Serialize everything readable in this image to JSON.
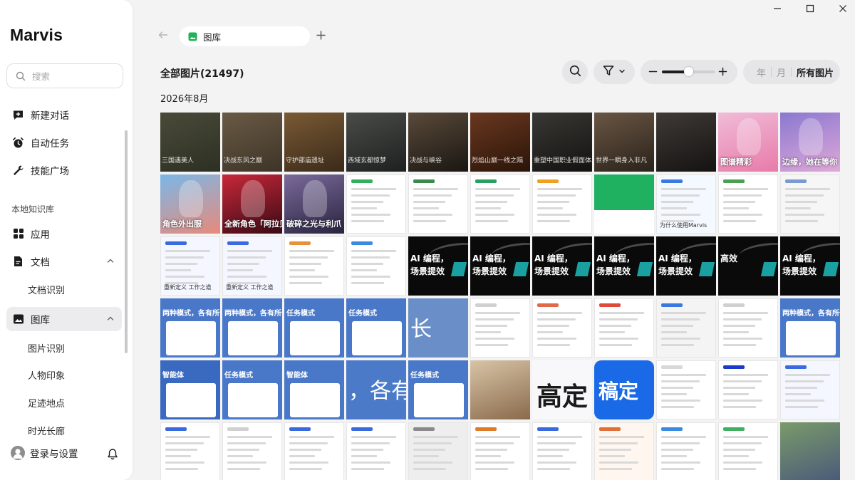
{
  "app": {
    "title": "Marvis"
  },
  "sidebar": {
    "search_placeholder": "搜索",
    "top_items": [
      {
        "label": "新建对话",
        "icon": "new-chat-icon"
      },
      {
        "label": "自动任务",
        "icon": "alarm-clock-icon"
      },
      {
        "label": "技能广场",
        "icon": "wrench-icon"
      }
    ],
    "section_label": "本地知识库",
    "kb_items": [
      {
        "label": "应用",
        "icon": "apps-grid-icon"
      },
      {
        "label": "文档",
        "icon": "document-icon"
      },
      {
        "label": "文档识别"
      },
      {
        "label": "图库",
        "icon": "gallery-icon"
      },
      {
        "label": "图片识别"
      },
      {
        "label": "人物印象"
      },
      {
        "label": "足迹地点"
      },
      {
        "label": "时光长廊"
      }
    ],
    "footer": {
      "login_label": "登录与设置"
    }
  },
  "tabs": [
    {
      "label": "图库",
      "icon": "gallery-icon"
    }
  ],
  "header": {
    "title": "全部图片(21497)",
    "zoom_level_fraction": 0.5,
    "segments": [
      {
        "label": "年",
        "selected": false
      },
      {
        "label": "月",
        "selected": false
      },
      {
        "label": "所有图片",
        "selected": true
      }
    ]
  },
  "group": {
    "date_label": "2026年8月",
    "rows": [
      [
        {
          "kind": "photo",
          "bg": "#4a4a3a",
          "bg2": "#2c3022",
          "caption": "三国遇美人"
        },
        {
          "kind": "photo",
          "bg": "#6a5a44",
          "bg2": "#3d3428",
          "caption": "决战东风之巅"
        },
        {
          "kind": "photo",
          "bg": "#7a5a34",
          "bg2": "#3a2a1a",
          "caption": "守护邵庙遗址"
        },
        {
          "kind": "photo",
          "bg": "#4a4c48",
          "bg2": "#1e2020",
          "caption": "西域玄都惊梦"
        },
        {
          "kind": "photo",
          "bg": "#5a4a3a",
          "bg2": "#1a1612",
          "caption": "决战与峡谷"
        },
        {
          "kind": "photo",
          "bg": "#6a3820",
          "bg2": "#2a1408",
          "caption": "烈焰山巅一线之隔"
        },
        {
          "kind": "photo",
          "bg": "#3a3834",
          "bg2": "#141210",
          "caption": "重塑中国职业假面体系"
        },
        {
          "kind": "photo",
          "bg": "#6a5644",
          "bg2": "#2a221a",
          "caption": "世界一瞬身入非凡"
        },
        {
          "kind": "photo",
          "bg": "#403a36",
          "bg2": "#141212",
          "caption": ""
        },
        {
          "kind": "anime",
          "bg": "#f0bcd8",
          "bg2": "#e87aa8",
          "big": "图谱精彩"
        },
        {
          "kind": "anime",
          "bg": "#8a78d0",
          "bg2": "#e0a8d8",
          "big": "边缘，她在等你"
        }
      ],
      [
        {
          "kind": "anime",
          "bg": "#7ab8e8",
          "bg2": "#e88a7a",
          "big": "角色外出服"
        },
        {
          "kind": "anime",
          "bg": "#c8283a",
          "bg2": "#3a0a14",
          "big": "全新角色「阿拉贝拉」"
        },
        {
          "kind": "anime",
          "bg": "#7a6a9a",
          "bg2": "#2a2440",
          "big": "破碎之光与利爪"
        },
        {
          "kind": "doc",
          "bg": "#ffffff",
          "accent": "#2fb05a"
        },
        {
          "kind": "doc",
          "bg": "#ffffff",
          "accent": "#3a8a4a"
        },
        {
          "kind": "doc",
          "bg": "#ffffff",
          "accent": "#2aa060"
        },
        {
          "kind": "doc",
          "bg": "#ffffff",
          "accent": "#f0a020"
        },
        {
          "kind": "green",
          "bg": "#1fb060",
          "bg2": "#ffffff"
        },
        {
          "kind": "doc",
          "bg": "#f4f8ff",
          "accent": "#3a7ae0",
          "caption": "为什么使用Marvis"
        },
        {
          "kind": "doc",
          "bg": "#ffffff",
          "accent": "#4aa050"
        },
        {
          "kind": "doc",
          "bg": "#f6f6f6",
          "accent": "#7a9ad0"
        }
      ],
      [
        {
          "kind": "doc",
          "bg": "#f4f7ff",
          "accent": "#3a6ae0",
          "caption": "重新定义 工作之道"
        },
        {
          "kind": "doc",
          "bg": "#f4f7ff",
          "accent": "#3a6ae0",
          "caption": "重新定义 工作之道"
        },
        {
          "kind": "doc",
          "bg": "#ffffff",
          "accent": "#e8903a"
        },
        {
          "kind": "doc",
          "bg": "#ffffff",
          "accent": "#3a8ae0"
        },
        {
          "kind": "dark",
          "bg": "#0a0a0a",
          "accent": "#1aa0a0",
          "big": "AI 编程，",
          "big2": "场景提效"
        },
        {
          "kind": "dark",
          "bg": "#0a0a0a",
          "accent": "#1aa0a0",
          "big": "AI 编程，",
          "big2": "场景提效"
        },
        {
          "kind": "dark",
          "bg": "#0a0a0a",
          "accent": "#1aa0a0",
          "big": "AI 编程，",
          "big2": "场景提效"
        },
        {
          "kind": "dark",
          "bg": "#0a0a0a",
          "accent": "#1aa0a0",
          "big": "AI 编程，",
          "big2": "场景提效"
        },
        {
          "kind": "dark",
          "bg": "#0a0a0a",
          "accent": "#1aa0a0",
          "big": "AI 编程，",
          "big2": "场景提效"
        },
        {
          "kind": "dark",
          "bg": "#0a0a0a",
          "accent": "#1aa0a0",
          "big": "高效",
          "big2": ""
        },
        {
          "kind": "dark",
          "bg": "#0a0a0a",
          "accent": "#1aa0a0",
          "big": "AI 编程，",
          "big2": "场景提效"
        }
      ],
      [
        {
          "kind": "blue",
          "bg": "#4a78c8",
          "big": "两种模式，各有所长"
        },
        {
          "kind": "blue",
          "bg": "#4a78c8",
          "big": "两种模式，各有所长"
        },
        {
          "kind": "blue",
          "bg": "#4a78c8",
          "big": "任务模式"
        },
        {
          "kind": "blue",
          "bg": "#4a78c8",
          "big": "任务模式"
        },
        {
          "kind": "bluebig",
          "bg": "#6a8ec8",
          "big": "长"
        },
        {
          "kind": "doc",
          "bg": "#ffffff",
          "accent": "#d0d0d0"
        },
        {
          "kind": "doc",
          "bg": "#ffffff",
          "accent": "#e06a4a"
        },
        {
          "kind": "doc",
          "bg": "#ffffff",
          "accent": "#e04a3a"
        },
        {
          "kind": "doc",
          "bg": "#f4f4f4",
          "accent": "#3a7ae0"
        },
        {
          "kind": "doc",
          "bg": "#ffffff",
          "accent": "#d0d0d0"
        },
        {
          "kind": "blue",
          "bg": "#4a78c8",
          "big": "两种模式，各有所长"
        }
      ],
      [
        {
          "kind": "blue",
          "bg": "#3a6ac0",
          "big": "智能体"
        },
        {
          "kind": "blue",
          "bg": "#4a78c8",
          "big": "任务模式"
        },
        {
          "kind": "blue",
          "bg": "#4a78c8",
          "big": "智能体"
        },
        {
          "kind": "bluebig",
          "bg": "#4a7ac8",
          "big": "，各有"
        },
        {
          "kind": "blue",
          "bg": "#4a78c8",
          "big": "任务模式"
        },
        {
          "kind": "photo",
          "bg": "#d8c4a8",
          "bg2": "#8a6a4a",
          "caption": ""
        },
        {
          "kind": "bigtext",
          "bg": "#f8f8fa",
          "color": "#1a1a1a",
          "big": "高定"
        },
        {
          "kind": "bigtext",
          "bg": "#1a6ae8",
          "color": "#ffffff",
          "big": "稿定"
        },
        {
          "kind": "doc",
          "bg": "#ffffff",
          "accent": "#d8d8d8"
        },
        {
          "kind": "doc",
          "bg": "#ffffff",
          "accent": "#1a3ac8"
        },
        {
          "kind": "doc",
          "bg": "#f4f7ff",
          "accent": "#3a6ae0"
        }
      ],
      [
        {
          "kind": "doc",
          "bg": "#ffffff",
          "accent": "#3a6ae0"
        },
        {
          "kind": "doc",
          "bg": "#ffffff",
          "accent": "#d0d0d0"
        },
        {
          "kind": "doc",
          "bg": "#ffffff",
          "accent": "#3a6ae0"
        },
        {
          "kind": "doc",
          "bg": "#ffffff",
          "accent": "#3a6ae0"
        },
        {
          "kind": "doc",
          "bg": "#eeeeee",
          "accent": "#8a8a8a"
        },
        {
          "kind": "doc",
          "bg": "#ffffff",
          "accent": "#e07a2a"
        },
        {
          "kind": "doc",
          "bg": "#ffffff",
          "accent": "#3a6ae0"
        },
        {
          "kind": "doc",
          "bg": "#fff6f0",
          "accent": "#e0703a"
        },
        {
          "kind": "doc",
          "bg": "#ffffff",
          "accent": "#3a8ae0"
        },
        {
          "kind": "doc",
          "bg": "#ffffff",
          "accent": "#40b060"
        },
        {
          "kind": "photo",
          "bg": "#7a9a6a",
          "bg2": "#4a5a7a",
          "caption": ""
        }
      ]
    ]
  }
}
